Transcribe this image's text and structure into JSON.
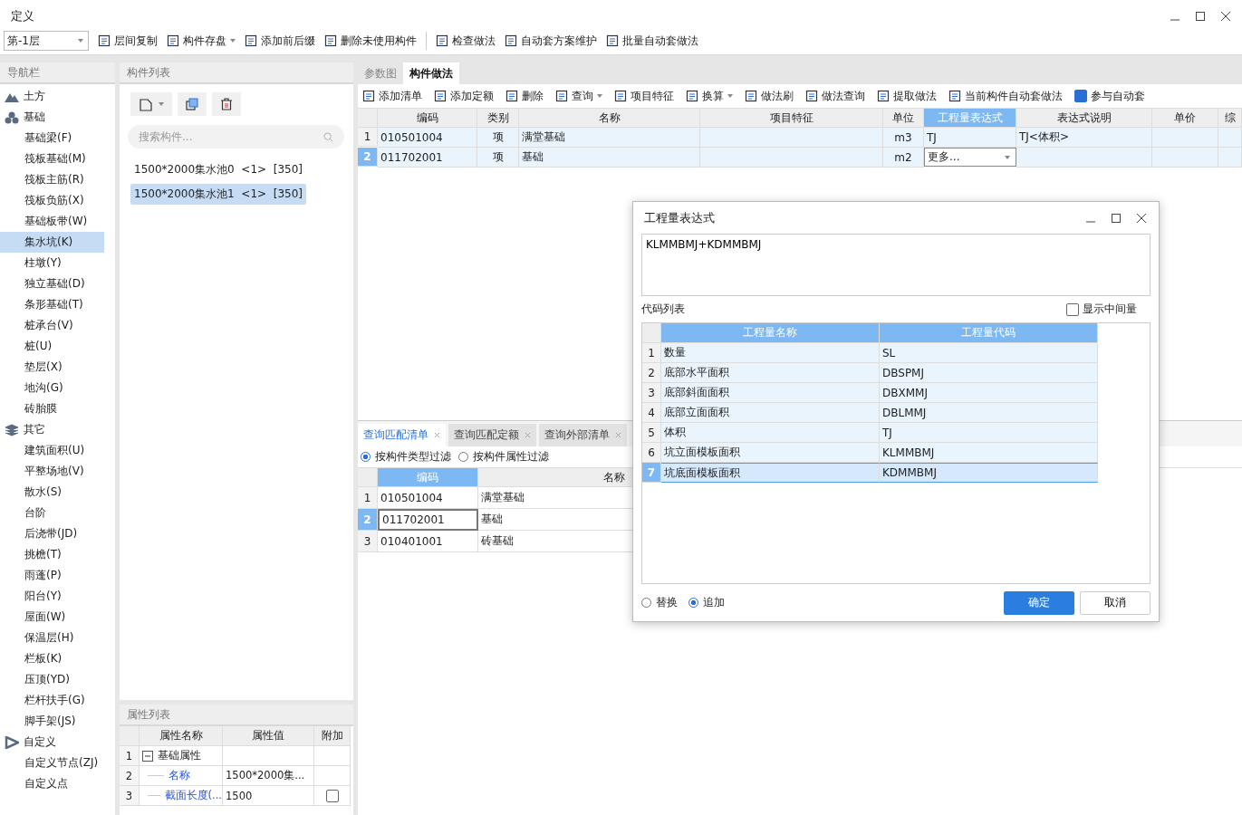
{
  "window": {
    "title": "定义"
  },
  "toolbar": {
    "floor": "第-1层",
    "items": [
      {
        "label": "层间复制",
        "dropdown": false
      },
      {
        "label": "构件存盘",
        "dropdown": true
      },
      {
        "label": "添加前后缀",
        "dropdown": false
      },
      {
        "label": "删除未使用构件",
        "dropdown": false
      },
      {
        "label": "检查做法",
        "dropdown": false
      },
      {
        "label": "自动套方案维护",
        "dropdown": false
      },
      {
        "label": "批量自动套做法",
        "dropdown": false
      }
    ]
  },
  "nav": {
    "title": "导航栏",
    "groups": [
      {
        "label": "土方"
      },
      {
        "label": "基础",
        "children": [
          {
            "label": "基础梁(F)",
            "selected": false
          },
          {
            "label": "筏板基础(M)",
            "selected": false
          },
          {
            "label": "筏板主筋(R)",
            "selected": false
          },
          {
            "label": "筏板负筋(X)",
            "selected": false
          },
          {
            "label": "基础板带(W)",
            "selected": false
          },
          {
            "label": "集水坑(K)",
            "selected": true
          },
          {
            "label": "柱墩(Y)",
            "selected": false
          },
          {
            "label": "独立基础(D)",
            "selected": false
          },
          {
            "label": "条形基础(T)",
            "selected": false
          },
          {
            "label": "桩承台(V)",
            "selected": false
          },
          {
            "label": "桩(U)",
            "selected": false
          },
          {
            "label": "垫层(X)",
            "selected": false
          },
          {
            "label": "地沟(G)",
            "selected": false
          },
          {
            "label": "砖胎膜",
            "selected": false
          }
        ]
      },
      {
        "label": "其它",
        "children": [
          {
            "label": "建筑面积(U)",
            "selected": false
          },
          {
            "label": "平整场地(V)",
            "selected": false
          },
          {
            "label": "散水(S)",
            "selected": false
          },
          {
            "label": "台阶",
            "selected": false
          },
          {
            "label": "后浇带(JD)",
            "selected": false
          },
          {
            "label": "挑檐(T)",
            "selected": false
          },
          {
            "label": "雨蓬(P)",
            "selected": false
          },
          {
            "label": "阳台(Y)",
            "selected": false
          },
          {
            "label": "屋面(W)",
            "selected": false
          },
          {
            "label": "保温层(H)",
            "selected": false
          },
          {
            "label": "栏板(K)",
            "selected": false
          },
          {
            "label": "压顶(YD)",
            "selected": false
          },
          {
            "label": "栏杆扶手(G)",
            "selected": false
          },
          {
            "label": "脚手架(JS)",
            "selected": false
          }
        ]
      },
      {
        "label": "自定义",
        "children": [
          {
            "label": "自定义节点(ZJ)",
            "selected": false
          },
          {
            "label": "自定义点",
            "selected": false
          }
        ]
      }
    ]
  },
  "component_list": {
    "title": "构件列表",
    "search": {
      "placeholder": "搜索构件..."
    },
    "items": [
      {
        "label": "1500*2000集水池0  <1>  [350]",
        "selected": false
      },
      {
        "label": "1500*2000集水池1  <1>  [350]",
        "selected": true
      }
    ]
  },
  "properties": {
    "title": "属性列表",
    "columns": [
      "属性名称",
      "属性值",
      "附加"
    ],
    "rows": [
      {
        "num": "1",
        "name": "基础属性",
        "kind": "group",
        "expanded": true
      },
      {
        "num": "2",
        "name": "名称",
        "kind": "plain",
        "value": "1500*2000集..."
      },
      {
        "num": "3",
        "name": "截面长度(...",
        "kind": "check",
        "value": "1500",
        "checked": false
      }
    ]
  },
  "method_tabs": [
    {
      "label": "参数图",
      "selected": false
    },
    {
      "label": "构件做法",
      "selected": true
    }
  ],
  "method_toolbar": [
    {
      "label": "添加清单",
      "dropdown": false
    },
    {
      "label": "添加定额",
      "dropdown": false
    },
    {
      "label": "删除",
      "dropdown": false
    },
    {
      "label": "查询",
      "dropdown": true
    },
    {
      "label": "项目特征",
      "dropdown": false
    },
    {
      "label": "换算",
      "dropdown": true
    },
    {
      "label": "做法刷",
      "dropdown": false
    },
    {
      "label": "做法查询",
      "dropdown": false
    },
    {
      "label": "提取做法",
      "dropdown": false
    },
    {
      "label": "当前构件自动套做法",
      "dropdown": false
    }
  ],
  "auto_match": {
    "label": "参与自动套",
    "checked": true
  },
  "method_table": {
    "columns": [
      {
        "label": "编码",
        "selected": false
      },
      {
        "label": "类别",
        "selected": false
      },
      {
        "label": "名称",
        "selected": false
      },
      {
        "label": "项目特征",
        "selected": false
      },
      {
        "label": "单位",
        "selected": false
      },
      {
        "label": "工程量表达式",
        "selected": true
      },
      {
        "label": "表达式说明",
        "selected": false
      },
      {
        "label": "单价",
        "selected": false
      },
      {
        "label": "综",
        "selected": false
      }
    ],
    "rows": [
      {
        "num": "1",
        "selected": false,
        "cells": [
          "010501004",
          "项",
          "满堂基础",
          "",
          "m3",
          "TJ",
          "TJ<体积>",
          "",
          ""
        ],
        "editing": false
      },
      {
        "num": "2",
        "selected": true,
        "cells": [
          "011702001",
          "项",
          "基础",
          "",
          "m2",
          "更多...",
          "",
          "",
          ""
        ],
        "editing": true
      }
    ]
  },
  "query_tabs": [
    {
      "label": "查询匹配清单",
      "selected": true
    },
    {
      "label": "查询匹配定额",
      "selected": false
    },
    {
      "label": "查询外部清单",
      "selected": false
    }
  ],
  "filters": [
    {
      "label": "按构件类型过滤",
      "selected": true
    },
    {
      "label": "按构件属性过滤",
      "selected": false
    }
  ],
  "query_table": {
    "columns": [
      {
        "label": "编码",
        "selected": true
      },
      {
        "label": "名称",
        "selected": false
      }
    ],
    "rows": [
      {
        "num": "1",
        "selected": false,
        "cells": [
          "010501004",
          "满堂基础"
        ]
      },
      {
        "num": "2",
        "selected": true,
        "cells": [
          "011702001",
          "基础"
        ]
      },
      {
        "num": "3",
        "selected": false,
        "cells": [
          "010401001",
          "砖基础"
        ]
      }
    ]
  },
  "dialog": {
    "title": "工程量表达式",
    "expression": "KLMMBMJ+KDMMBMJ",
    "code_list_label": "代码列表",
    "show_intermediate": {
      "label": "显示中间量",
      "checked": false
    },
    "columns": [
      "工程量名称",
      "工程量代码"
    ],
    "rows": [
      {
        "num": "1",
        "name": "数量",
        "code": "SL",
        "selected": false
      },
      {
        "num": "2",
        "name": "底部水平面积",
        "code": "DBSPMJ",
        "selected": false
      },
      {
        "num": "3",
        "name": "底部斜面面积",
        "code": "DBXMMJ",
        "selected": false
      },
      {
        "num": "4",
        "name": "底部立面面积",
        "code": "DBLMMJ",
        "selected": false
      },
      {
        "num": "5",
        "name": "体积",
        "code": "TJ",
        "selected": false
      },
      {
        "num": "6",
        "name": "坑立面模板面积",
        "code": "KLMMBMJ",
        "selected": false
      },
      {
        "num": "7",
        "name": "坑底面模板面积",
        "code": "KDMMBMJ",
        "selected": true
      }
    ],
    "modes": [
      {
        "label": "替换",
        "selected": false
      },
      {
        "label": "追加",
        "selected": true
      }
    ],
    "buttons": [
      {
        "label": "确定",
        "kind": "primary"
      },
      {
        "label": "取消",
        "kind": "secondary"
      }
    ]
  }
}
